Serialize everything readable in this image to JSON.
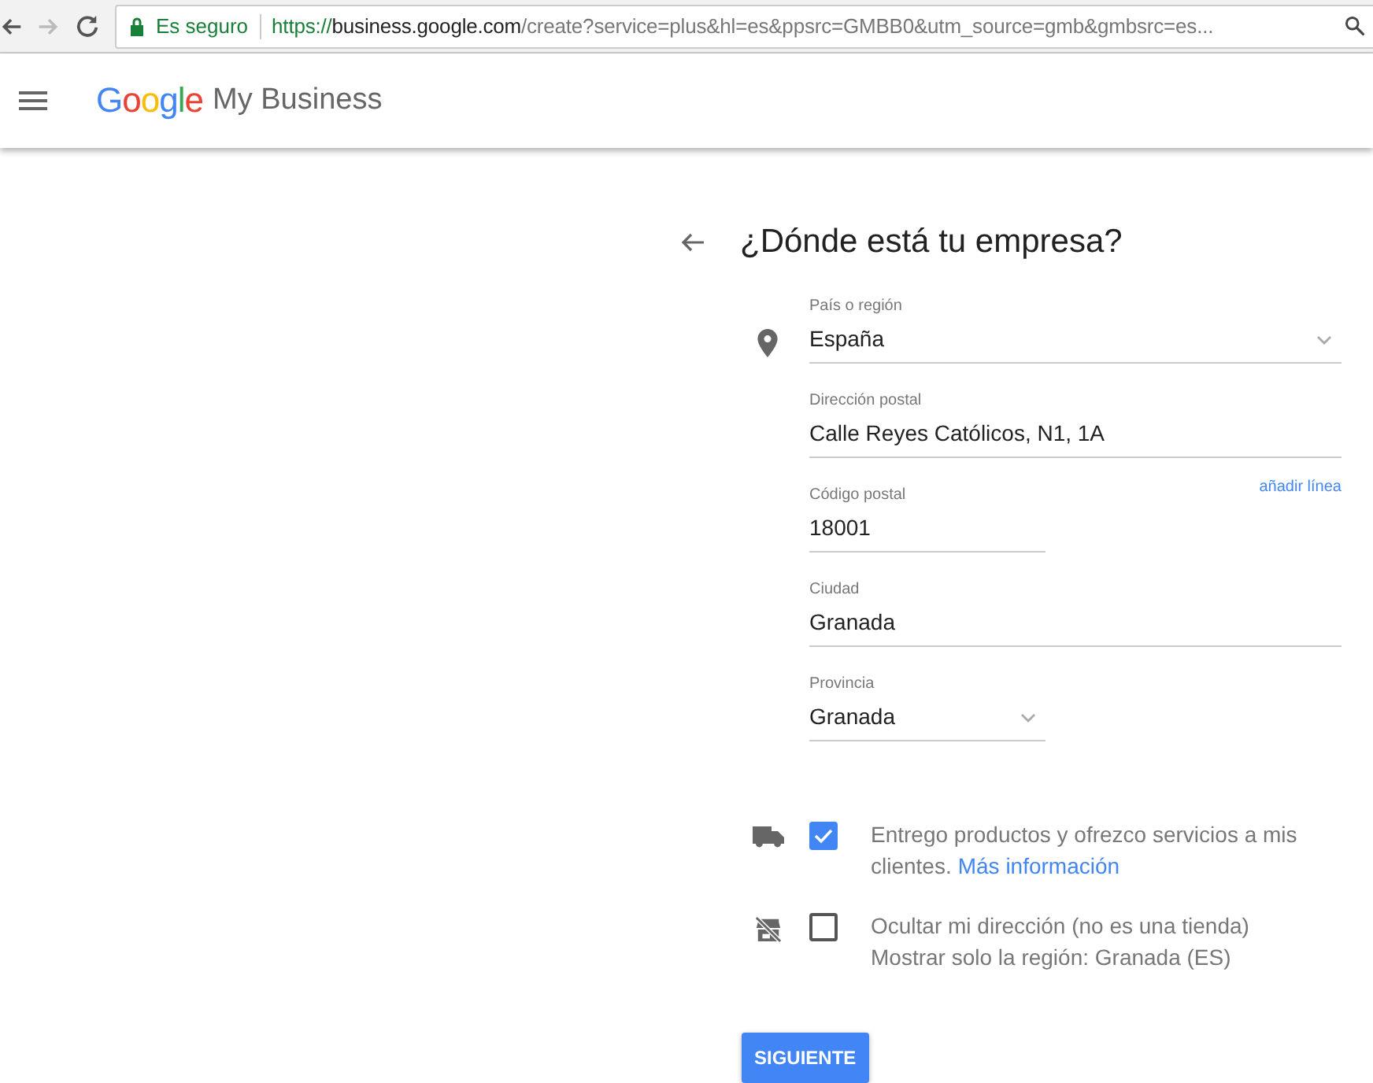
{
  "browser": {
    "secure_label": "Es seguro",
    "url_scheme": "https://",
    "url_host": "business.google.com",
    "url_path": "/create?service=plus&hl=es&ppsrc=GMBB0&utm_source=gmb&gmbsrc=es..."
  },
  "header": {
    "logo": "Google",
    "product": "My Business"
  },
  "title": "¿Dónde está tu empresa?",
  "form": {
    "country": {
      "label": "País o región",
      "value": "España"
    },
    "address": {
      "label": "Dirección postal",
      "value": "Calle Reyes Católicos, N1, 1A"
    },
    "add_line": "añadir línea",
    "postal_code": {
      "label": "Código postal",
      "value": "18001"
    },
    "city": {
      "label": "Ciudad",
      "value": "Granada"
    },
    "province": {
      "label": "Provincia",
      "value": "Granada"
    }
  },
  "options": [
    {
      "checked": true,
      "text": "Entrego productos y ofrezco servicios a mis clientes.",
      "link": "Más información"
    },
    {
      "checked": false,
      "text": "Ocultar mi dirección (no es una tienda)",
      "detail": "Mostrar solo la región: Granada (ES)"
    }
  ],
  "next_button": "SIGUIENTE"
}
